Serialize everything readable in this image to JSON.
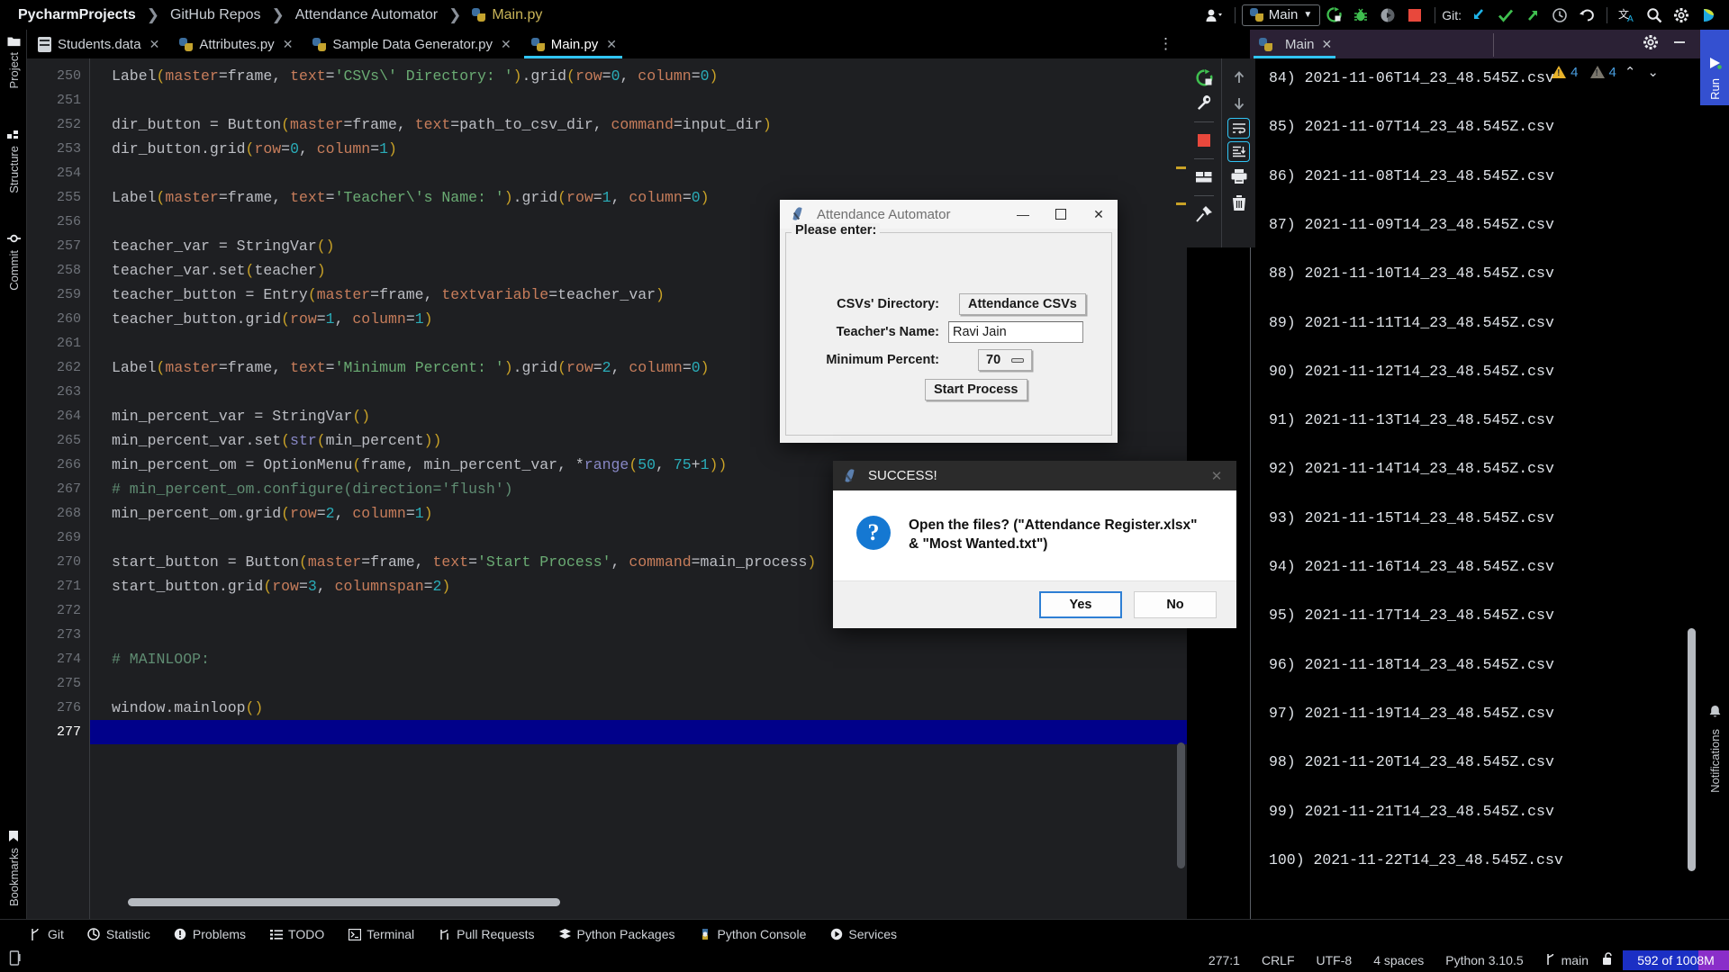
{
  "colors": {
    "accent_blue": "#31c5f5",
    "run_green": "#3fbf4f",
    "stop_red": "#e8483c",
    "caret_line": "#01018a",
    "memory_blue": "#1b2fc4",
    "memory_purple": "#8a2ec9",
    "editor_bg": "#1e1f22",
    "string_green": "#6aab73",
    "kwarg_orange": "#c77d5b",
    "number_cyan": "#2aacb8",
    "paren_yellow": "#c9a227",
    "comment_green": "#5f8c72"
  },
  "titlebar": {
    "breadcrumb": [
      "PycharmProjects",
      "GitHub Repos",
      "Attendance Automator"
    ],
    "breadcrumb_file": "Main.py",
    "separator": "❯",
    "account_icon": "user-account-icon",
    "run_config": {
      "label": "Main",
      "icon": "python-file-icon",
      "chevron": "▼"
    },
    "actions": [
      {
        "name": "rerun-icon",
        "glyph": "⟳"
      },
      {
        "name": "debug-icon",
        "glyph": "✱"
      },
      {
        "name": "coverage-icon",
        "glyph": "◗"
      },
      {
        "name": "stop-icon",
        "glyph": "■"
      }
    ],
    "git_label": "Git:",
    "git_actions": [
      {
        "name": "git-update-icon",
        "glyph": "↙"
      },
      {
        "name": "git-commit-icon",
        "glyph": "✔"
      },
      {
        "name": "git-push-icon",
        "glyph": "↗"
      },
      {
        "name": "git-history-icon",
        "glyph": "◴"
      },
      {
        "name": "git-rollback-icon",
        "glyph": "↺"
      }
    ],
    "right_actions": [
      {
        "name": "translate-icon",
        "glyph": "文"
      },
      {
        "name": "search-icon",
        "glyph": "⚲"
      },
      {
        "name": "settings-gear-icon",
        "glyph": "⚙"
      },
      {
        "name": "ide-logo-icon",
        "glyph": "◗"
      }
    ]
  },
  "left_strip": [
    {
      "label": "Project",
      "icon": "folder-icon"
    },
    {
      "label": "Structure",
      "icon": "structure-icon"
    },
    {
      "label": "Commit",
      "icon": "commit-icon"
    },
    {
      "label": "Bookmarks",
      "icon": "bookmark-icon"
    }
  ],
  "tabs": [
    {
      "label": "Students.data",
      "icon": "data-file-icon",
      "active": false
    },
    {
      "label": "Attributes.py",
      "icon": "python-file-icon",
      "active": false
    },
    {
      "label": "Sample Data Generator.py",
      "icon": "python-file-icon",
      "active": false
    },
    {
      "label": "Main.py",
      "icon": "python-file-icon",
      "active": true
    }
  ],
  "tab_overflow_icon": "tab-list-menu-icon",
  "inspection": {
    "warning_count": "4",
    "weak_warning_count": "4",
    "prev_glyph": "⌃",
    "next_glyph": "⌄"
  },
  "editor": {
    "first_line_number": 250,
    "caret_line_number": 277,
    "lines": [
      {
        "n": 250,
        "tokens": [
          {
            "t": "Label",
            "c": "def"
          },
          {
            "t": "(",
            "c": "paren"
          },
          {
            "t": "master",
            "c": "kwarg"
          },
          {
            "t": "=frame, ",
            "c": "def"
          },
          {
            "t": "text",
            "c": "kwarg"
          },
          {
            "t": "=",
            "c": "def"
          },
          {
            "t": "'CSVs\\' Directory: '",
            "c": "str"
          },
          {
            "t": ")",
            "c": "paren"
          },
          {
            "t": ".grid",
            "c": "def"
          },
          {
            "t": "(",
            "c": "paren"
          },
          {
            "t": "row",
            "c": "kwarg"
          },
          {
            "t": "=",
            "c": "def"
          },
          {
            "t": "0",
            "c": "num"
          },
          {
            "t": ", ",
            "c": "def"
          },
          {
            "t": "column",
            "c": "kwarg"
          },
          {
            "t": "=",
            "c": "def"
          },
          {
            "t": "0",
            "c": "num"
          },
          {
            "t": ")",
            "c": "paren"
          }
        ]
      },
      {
        "n": 251,
        "tokens": []
      },
      {
        "n": 252,
        "tokens": [
          {
            "t": "dir_button = Button",
            "c": "def"
          },
          {
            "t": "(",
            "c": "paren"
          },
          {
            "t": "master",
            "c": "kwarg"
          },
          {
            "t": "=frame, ",
            "c": "def"
          },
          {
            "t": "text",
            "c": "kwarg"
          },
          {
            "t": "=path_to_csv_dir, ",
            "c": "def"
          },
          {
            "t": "command",
            "c": "kwarg"
          },
          {
            "t": "=input_dir",
            "c": "def"
          },
          {
            "t": ")",
            "c": "paren"
          }
        ]
      },
      {
        "n": 253,
        "tokens": [
          {
            "t": "dir_button.grid",
            "c": "def"
          },
          {
            "t": "(",
            "c": "paren"
          },
          {
            "t": "row",
            "c": "kwarg"
          },
          {
            "t": "=",
            "c": "def"
          },
          {
            "t": "0",
            "c": "num"
          },
          {
            "t": ", ",
            "c": "def"
          },
          {
            "t": "column",
            "c": "kwarg"
          },
          {
            "t": "=",
            "c": "def"
          },
          {
            "t": "1",
            "c": "num"
          },
          {
            "t": ")",
            "c": "paren"
          }
        ]
      },
      {
        "n": 254,
        "tokens": []
      },
      {
        "n": 255,
        "tokens": [
          {
            "t": "Label",
            "c": "def"
          },
          {
            "t": "(",
            "c": "paren"
          },
          {
            "t": "master",
            "c": "kwarg"
          },
          {
            "t": "=frame, ",
            "c": "def"
          },
          {
            "t": "text",
            "c": "kwarg"
          },
          {
            "t": "=",
            "c": "def"
          },
          {
            "t": "'Teacher\\'s Name: '",
            "c": "str"
          },
          {
            "t": ")",
            "c": "paren"
          },
          {
            "t": ".grid",
            "c": "def"
          },
          {
            "t": "(",
            "c": "paren"
          },
          {
            "t": "row",
            "c": "kwarg"
          },
          {
            "t": "=",
            "c": "def"
          },
          {
            "t": "1",
            "c": "num"
          },
          {
            "t": ", ",
            "c": "def"
          },
          {
            "t": "column",
            "c": "kwarg"
          },
          {
            "t": "=",
            "c": "def"
          },
          {
            "t": "0",
            "c": "num"
          },
          {
            "t": ")",
            "c": "paren"
          }
        ]
      },
      {
        "n": 256,
        "tokens": []
      },
      {
        "n": 257,
        "tokens": [
          {
            "t": "teacher_var = StringVar",
            "c": "def"
          },
          {
            "t": "()",
            "c": "paren"
          }
        ]
      },
      {
        "n": 258,
        "tokens": [
          {
            "t": "teacher_var.set",
            "c": "def"
          },
          {
            "t": "(",
            "c": "paren"
          },
          {
            "t": "teacher",
            "c": "def"
          },
          {
            "t": ")",
            "c": "paren"
          }
        ]
      },
      {
        "n": 259,
        "tokens": [
          {
            "t": "teacher_button = Entry",
            "c": "def"
          },
          {
            "t": "(",
            "c": "paren"
          },
          {
            "t": "master",
            "c": "kwarg"
          },
          {
            "t": "=frame, ",
            "c": "def"
          },
          {
            "t": "textvariable",
            "c": "kwarg"
          },
          {
            "t": "=teacher_var",
            "c": "def"
          },
          {
            "t": ")",
            "c": "paren"
          }
        ]
      },
      {
        "n": 260,
        "tokens": [
          {
            "t": "teacher_button.grid",
            "c": "def"
          },
          {
            "t": "(",
            "c": "paren"
          },
          {
            "t": "row",
            "c": "kwarg"
          },
          {
            "t": "=",
            "c": "def"
          },
          {
            "t": "1",
            "c": "num"
          },
          {
            "t": ", ",
            "c": "def"
          },
          {
            "t": "column",
            "c": "kwarg"
          },
          {
            "t": "=",
            "c": "def"
          },
          {
            "t": "1",
            "c": "num"
          },
          {
            "t": ")",
            "c": "paren"
          }
        ]
      },
      {
        "n": 261,
        "tokens": []
      },
      {
        "n": 262,
        "tokens": [
          {
            "t": "Label",
            "c": "def"
          },
          {
            "t": "(",
            "c": "paren"
          },
          {
            "t": "master",
            "c": "kwarg"
          },
          {
            "t": "=frame, ",
            "c": "def"
          },
          {
            "t": "text",
            "c": "kwarg"
          },
          {
            "t": "=",
            "c": "def"
          },
          {
            "t": "'Minimum Percent: '",
            "c": "str"
          },
          {
            "t": ")",
            "c": "paren"
          },
          {
            "t": ".grid",
            "c": "def"
          },
          {
            "t": "(",
            "c": "paren"
          },
          {
            "t": "row",
            "c": "kwarg"
          },
          {
            "t": "=",
            "c": "def"
          },
          {
            "t": "2",
            "c": "num"
          },
          {
            "t": ", ",
            "c": "def"
          },
          {
            "t": "column",
            "c": "kwarg"
          },
          {
            "t": "=",
            "c": "def"
          },
          {
            "t": "0",
            "c": "num"
          },
          {
            "t": ")",
            "c": "paren"
          }
        ]
      },
      {
        "n": 263,
        "tokens": []
      },
      {
        "n": 264,
        "tokens": [
          {
            "t": "min_percent_var = StringVar",
            "c": "def"
          },
          {
            "t": "()",
            "c": "paren"
          }
        ]
      },
      {
        "n": 265,
        "tokens": [
          {
            "t": "min_percent_var.set",
            "c": "def"
          },
          {
            "t": "(",
            "c": "paren"
          },
          {
            "t": "str",
            "c": "builtin"
          },
          {
            "t": "(",
            "c": "paren"
          },
          {
            "t": "min_percent",
            "c": "def"
          },
          {
            "t": "))",
            "c": "paren"
          }
        ]
      },
      {
        "n": 266,
        "tokens": [
          {
            "t": "min_percent_om = OptionMenu",
            "c": "def"
          },
          {
            "t": "(",
            "c": "paren"
          },
          {
            "t": "frame, min_percent_var, *",
            "c": "def"
          },
          {
            "t": "range",
            "c": "builtin"
          },
          {
            "t": "(",
            "c": "paren"
          },
          {
            "t": "50",
            "c": "num"
          },
          {
            "t": ", ",
            "c": "def"
          },
          {
            "t": "75",
            "c": "num"
          },
          {
            "t": "+",
            "c": "def"
          },
          {
            "t": "1",
            "c": "num"
          },
          {
            "t": "))",
            "c": "paren"
          }
        ]
      },
      {
        "n": 267,
        "tokens": [
          {
            "t": "# min_percent_om.configure(direction='flush')",
            "c": "comment"
          }
        ]
      },
      {
        "n": 268,
        "tokens": [
          {
            "t": "min_percent_om.grid",
            "c": "def"
          },
          {
            "t": "(",
            "c": "paren"
          },
          {
            "t": "row",
            "c": "kwarg"
          },
          {
            "t": "=",
            "c": "def"
          },
          {
            "t": "2",
            "c": "num"
          },
          {
            "t": ", ",
            "c": "def"
          },
          {
            "t": "column",
            "c": "kwarg"
          },
          {
            "t": "=",
            "c": "def"
          },
          {
            "t": "1",
            "c": "num"
          },
          {
            "t": ")",
            "c": "paren"
          }
        ]
      },
      {
        "n": 269,
        "tokens": []
      },
      {
        "n": 270,
        "tokens": [
          {
            "t": "start_button = Button",
            "c": "def"
          },
          {
            "t": "(",
            "c": "paren"
          },
          {
            "t": "master",
            "c": "kwarg"
          },
          {
            "t": "=frame, ",
            "c": "def"
          },
          {
            "t": "text",
            "c": "kwarg"
          },
          {
            "t": "=",
            "c": "def"
          },
          {
            "t": "'Start Process'",
            "c": "str"
          },
          {
            "t": ", ",
            "c": "def"
          },
          {
            "t": "command",
            "c": "kwarg"
          },
          {
            "t": "=main_process",
            "c": "def"
          },
          {
            "t": ")",
            "c": "paren"
          }
        ]
      },
      {
        "n": 271,
        "tokens": [
          {
            "t": "start_button.grid",
            "c": "def"
          },
          {
            "t": "(",
            "c": "paren"
          },
          {
            "t": "row",
            "c": "kwarg"
          },
          {
            "t": "=",
            "c": "def"
          },
          {
            "t": "3",
            "c": "num"
          },
          {
            "t": ", ",
            "c": "def"
          },
          {
            "t": "columnspan",
            "c": "kwarg"
          },
          {
            "t": "=",
            "c": "def"
          },
          {
            "t": "2",
            "c": "num"
          },
          {
            "t": ")",
            "c": "paren"
          }
        ]
      },
      {
        "n": 272,
        "tokens": []
      },
      {
        "n": 273,
        "tokens": []
      },
      {
        "n": 274,
        "tokens": [
          {
            "t": "# MAINLOOP:",
            "c": "comment"
          }
        ]
      },
      {
        "n": 275,
        "tokens": []
      },
      {
        "n": 276,
        "tokens": [
          {
            "t": "window.mainloop",
            "c": "def"
          },
          {
            "t": "()",
            "c": "paren"
          }
        ]
      },
      {
        "n": 277,
        "tokens": []
      }
    ],
    "right_gutter_col1": [
      {
        "name": "rerun-icon",
        "glyph": "⟳"
      },
      {
        "name": "wrench-settings-icon",
        "glyph": "ὒ7"
      },
      {
        "name": "stop-icon",
        "glyph": "■"
      },
      {
        "name": "layout-icon",
        "glyph": "⬒"
      },
      {
        "name": "pin-icon",
        "glyph": "ὌC"
      }
    ],
    "right_gutter_col2": [
      {
        "name": "scroll-up-icon",
        "glyph": "↑"
      },
      {
        "name": "scroll-down-icon",
        "glyph": "↓"
      },
      {
        "name": "soft-wrap-icon",
        "glyph": "↵"
      },
      {
        "name": "scroll-to-end-icon",
        "glyph": "⤓"
      },
      {
        "name": "print-icon",
        "glyph": "⎙"
      },
      {
        "name": "clear-all-icon",
        "glyph": "Ὕ1"
      }
    ]
  },
  "run_panel": {
    "prefix": "Run:",
    "tab_label": "Main",
    "tab_icon": "python-file-icon",
    "tab_close": "✕",
    "settings_icon": "settings-gear-icon",
    "minimize_icon": "minimize-icon",
    "console_lines": [
      "84) 2021-11-06T14_23_48.545Z.csv",
      "85) 2021-11-07T14_23_48.545Z.csv",
      "86) 2021-11-08T14_23_48.545Z.csv",
      "87) 2021-11-09T14_23_48.545Z.csv",
      "88) 2021-11-10T14_23_48.545Z.csv",
      "89) 2021-11-11T14_23_48.545Z.csv",
      "90) 2021-11-12T14_23_48.545Z.csv",
      "91) 2021-11-13T14_23_48.545Z.csv",
      "92) 2021-11-14T14_23_48.545Z.csv",
      "93) 2021-11-15T14_23_48.545Z.csv",
      "94) 2021-11-16T14_23_48.545Z.csv",
      "95) 2021-11-17T14_23_48.545Z.csv",
      "96) 2021-11-18T14_23_48.545Z.csv",
      "97) 2021-11-19T14_23_48.545Z.csv",
      "98) 2021-11-20T14_23_48.545Z.csv",
      "99) 2021-11-21T14_23_48.545Z.csv",
      "100) 2021-11-22T14_23_48.545Z.csv"
    ]
  },
  "right_strip": {
    "run_badge": {
      "label": "Run",
      "icon": "run-play-icon"
    },
    "notifications": {
      "label": "Notifications",
      "icon": "bell-icon"
    }
  },
  "bottom_bar": [
    {
      "label": "Git",
      "icon": "git-branch-icon"
    },
    {
      "label": "Statistic",
      "icon": "statistic-icon"
    },
    {
      "label": "Problems",
      "icon": "problems-icon"
    },
    {
      "label": "TODO",
      "icon": "todo-list-icon"
    },
    {
      "label": "Terminal",
      "icon": "terminal-icon"
    },
    {
      "label": "Pull Requests",
      "icon": "pull-request-icon"
    },
    {
      "label": "Python Packages",
      "icon": "packages-icon"
    },
    {
      "label": "Python Console",
      "icon": "python-console-icon"
    },
    {
      "label": "Services",
      "icon": "services-icon"
    }
  ],
  "status_bar": {
    "left_icon": "ide-status-icon",
    "caret_position": "277:1",
    "line_separator": "CRLF",
    "encoding": "UTF-8",
    "indent": "4 spaces",
    "interpreter": "Python 3.10.5",
    "branch": "main",
    "branch_icon": "git-branch-icon",
    "lock_icon": "lock-open-icon",
    "memory": "592 of 1008M"
  },
  "tk_dialog": {
    "title": "Attendance Automator",
    "icon": "tk-feather-icon",
    "window_buttons": [
      {
        "name": "minimize-button",
        "glyph": "—"
      },
      {
        "name": "maximize-button",
        "glyph": "☐"
      },
      {
        "name": "close-button",
        "glyph": "✕"
      }
    ],
    "group_label": "Please enter:",
    "fields": {
      "dir_label": "CSVs' Directory:",
      "dir_button": "Attendance CSVs",
      "teacher_label": "Teacher's Name:",
      "teacher_value": "Ravi Jain",
      "percent_label": "Minimum Percent:",
      "percent_value": "70"
    },
    "start_button": "Start Process"
  },
  "success_dialog": {
    "title": "SUCCESS!",
    "icon": "tk-feather-icon",
    "close_glyph": "✕",
    "question_glyph": "?",
    "message": "Open the files? (\"Attendance Register.xlsx\" & \"Most Wanted.txt\")",
    "yes_label": "Yes",
    "no_label": "No"
  }
}
